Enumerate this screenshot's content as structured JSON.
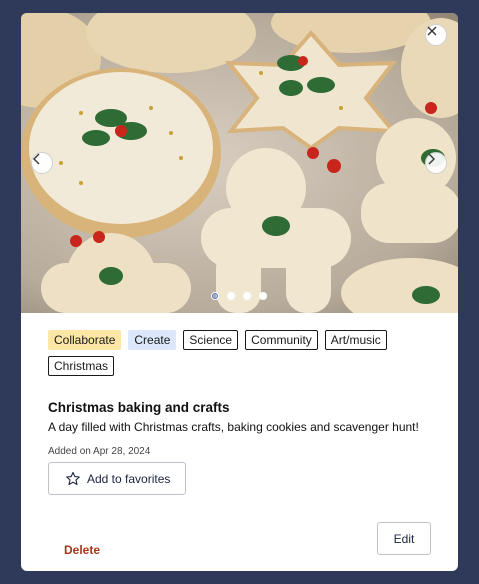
{
  "image": {
    "alt_icon": "cookies-photo",
    "slide_count": 4,
    "active_slide": 1
  },
  "controls": {
    "close_icon": "close-icon",
    "prev_icon": "chevron-left-icon",
    "next_icon": "chevron-right-icon"
  },
  "tags": [
    {
      "label": "Collaborate",
      "style": "yellow"
    },
    {
      "label": "Create",
      "style": "blue"
    },
    {
      "label": "Science",
      "style": "outline"
    },
    {
      "label": "Community",
      "style": "outline"
    },
    {
      "label": "Art/music",
      "style": "outline"
    },
    {
      "label": "Christmas",
      "style": "outline"
    }
  ],
  "activity": {
    "title": "Christmas baking and crafts",
    "description": "A day filled with Christmas crafts, baking cookies and scavenger hunt!",
    "added": "Added on Apr 28, 2024"
  },
  "actions": {
    "favorite_label": "Add to favorites",
    "favorite_icon": "star-outline-icon",
    "delete_label": "Delete",
    "edit_label": "Edit"
  },
  "colors": {
    "background": "#2f3a5a",
    "tag_yellow": "#fbe6a6",
    "tag_blue": "#dbe7fb",
    "delete_text": "#a8361a"
  }
}
